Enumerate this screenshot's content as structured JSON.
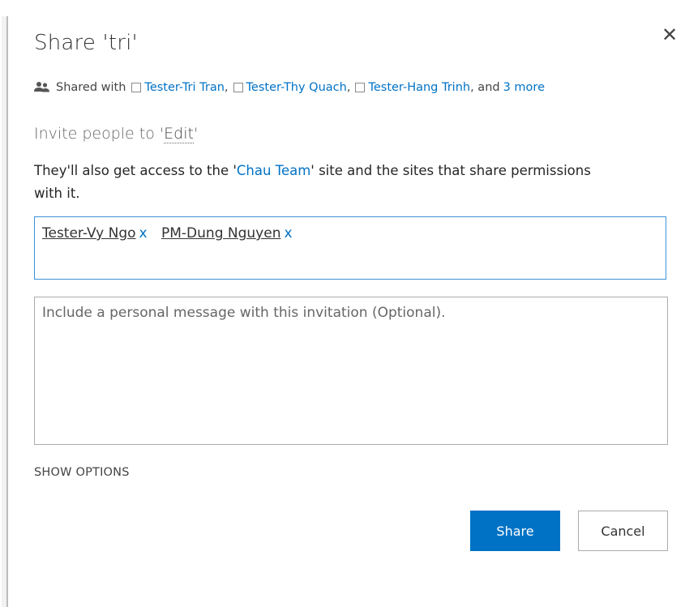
{
  "dialog": {
    "title": "Share 'tri'",
    "close_glyph": "✕"
  },
  "shared_with": {
    "icon": "people-icon",
    "label": "Shared with",
    "people": [
      {
        "name": "Tester-Tri Tran",
        "sep": ","
      },
      {
        "name": "Tester-Thy Quach",
        "sep": ","
      },
      {
        "name": "Tester-Hang Trinh",
        "sep": ", and"
      }
    ],
    "more_link": "3 more"
  },
  "invite": {
    "prefix": "Invite people to '",
    "permission": "Edit",
    "suffix": "'"
  },
  "access_note": {
    "before": "They'll also get access to the '",
    "site_link": "Chau Team",
    "after": "' site and the sites that share permissions with it."
  },
  "people_picker": {
    "chips": [
      {
        "name": "Tester-Vy Ngo",
        "remove": "x"
      },
      {
        "name": "PM-Dung Nguyen",
        "remove": "x"
      }
    ]
  },
  "message": {
    "value": "",
    "placeholder": "Include a personal message with this invitation (Optional)."
  },
  "show_options": "SHOW OPTIONS",
  "buttons": {
    "share": "Share",
    "cancel": "Cancel"
  },
  "colors": {
    "link": "#0072c6",
    "primary_button": "#0072c6",
    "focus_border": "#3c92d8"
  }
}
